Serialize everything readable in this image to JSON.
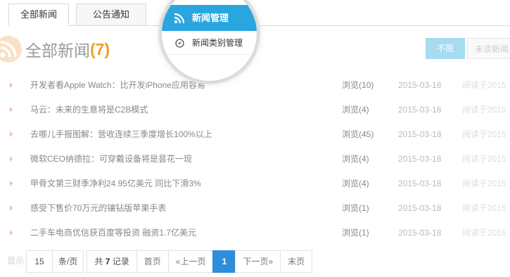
{
  "tabs": [
    {
      "label": "全部新闻"
    },
    {
      "label": "公告通知"
    }
  ],
  "heading": {
    "title": "全部新闻",
    "count": "(7)"
  },
  "filters": [
    {
      "label": "不限"
    },
    {
      "label": "未读新闻"
    }
  ],
  "news": [
    {
      "title": "开发者看Apple Watch：比开发iPhone应用容易",
      "views": "浏览(10)",
      "date": "2015-03-18",
      "reader": "阅读于2015"
    },
    {
      "title": "马云：未来的生意将是C2B模式",
      "views": "浏览(4)",
      "date": "2015-03-18",
      "reader": "阅读于2015"
    },
    {
      "title": "去哪儿手报图解：营收连续三季度增长100%以上",
      "views": "浏览(45)",
      "date": "2015-03-18",
      "reader": "阅读于2015"
    },
    {
      "title": "微软CEO纳德拉：可穿戴设备将是昙花一现",
      "views": "浏览(4)",
      "date": "2015-03-18",
      "reader": "阅读于2015"
    },
    {
      "title": "甲骨文第三财季净利24.95亿美元 同比下滑3%",
      "views": "浏览(4)",
      "date": "2015-03-18",
      "reader": "阅读于2015"
    },
    {
      "title": "感受下售价70万元的镶钻版苹果手表",
      "views": "浏览(1)",
      "date": "2015-03-18",
      "reader": "阅读于2015"
    },
    {
      "title": "二手车电商优信获百度等投资 融资1.7亿美元",
      "views": "浏览(1)",
      "date": "2015-03-18",
      "reader": "阅读于2015"
    }
  ],
  "pager": {
    "show_label": "显示",
    "page_size": "15",
    "unit": "条/页",
    "total_prefix": "共",
    "total": "7",
    "total_suffix": "记录",
    "first": "首页",
    "prev": "«上一页",
    "current": "1",
    "next": "下一页»",
    "last": "末页"
  },
  "magnifier": {
    "menu_active": "新闻管理",
    "menu_item": "新闻类别管理"
  },
  "colors": {
    "accent": "#29a6e0",
    "page_current": "#2e8ddc",
    "count": "#f0a020",
    "filter_active": "#a6dbf1"
  }
}
